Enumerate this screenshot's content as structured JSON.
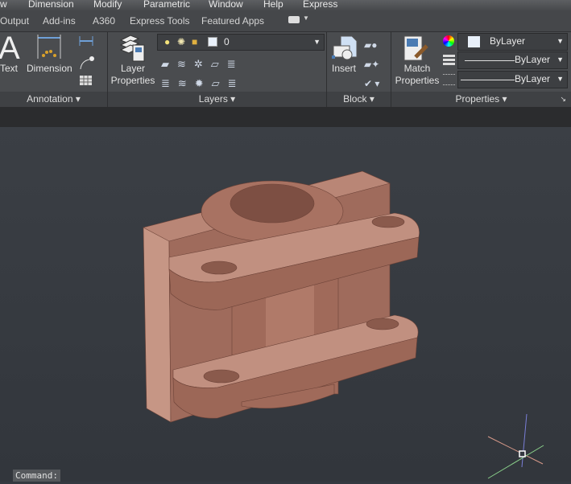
{
  "menu": [
    "w",
    "Dimension",
    "Modify",
    "Parametric",
    "Window",
    "Help",
    "Express"
  ],
  "tabs": [
    "Output",
    "Add-ins",
    "A360",
    "Express Tools",
    "Featured Apps"
  ],
  "annotation": {
    "text_label": "Text",
    "dimension_label": "Dimension",
    "panel_label": "Annotation"
  },
  "layers": {
    "layer_properties_label": [
      "Layer",
      "Properties"
    ],
    "current_layer": "0",
    "panel_label": "Layers"
  },
  "block": {
    "insert_label": "Insert",
    "panel_label": "Block"
  },
  "properties": {
    "match_label": [
      "Match",
      "Properties"
    ],
    "color": "ByLayer",
    "linetype": "ByLayer",
    "lineweight": "ByLayer",
    "panel_label": "Properties"
  },
  "command": {
    "prompt": "Command:"
  },
  "colors": {
    "model": "#a46f5f",
    "model_light": "#c08d7c",
    "model_dark": "#7d4f43"
  }
}
